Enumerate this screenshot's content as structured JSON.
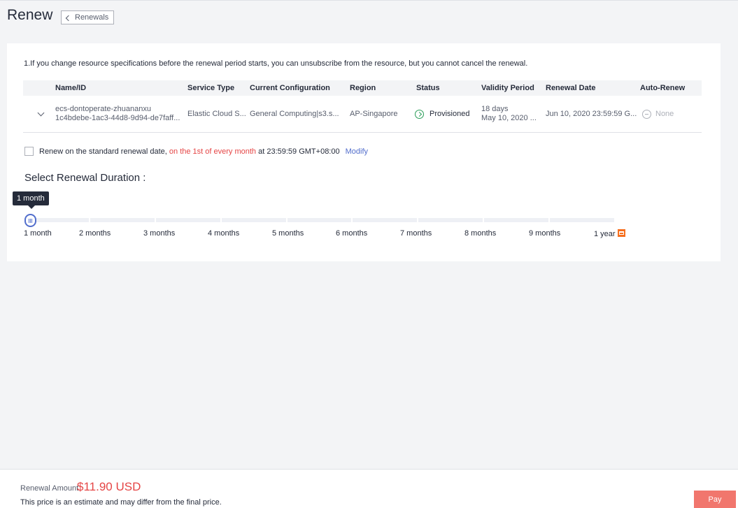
{
  "header": {
    "title": "Renew",
    "back_label": "Renewals"
  },
  "note": "1.If you change resource specifications before the renewal period starts, you can unsubscribe from the resource, but you cannot cancel the renewal.",
  "table": {
    "headers": [
      "Name/ID",
      "Service Type",
      "Current Configuration",
      "Region",
      "Status",
      "Validity Period",
      "Renewal Date",
      "Auto-Renew"
    ],
    "row": {
      "name": "ecs-dontoperate-zhuananxu",
      "id": "1c4bdebe-1ac3-44d8-9d94-de7faff...",
      "service_type": "Elastic Cloud S...",
      "configuration": "General Computing|s3.s...",
      "region": "AP-Singapore",
      "status": "Provisioned",
      "validity_days": "18 days",
      "validity_date": "May 10, 2020 ...",
      "renewal_date": "Jun 10, 2020 23:59:59 G...",
      "auto_renew": "None"
    }
  },
  "renew_option": {
    "prefix": "Renew on the standard renewal date,",
    "highlight": "on the 1st of every month",
    "suffix": "at 23:59:59 GMT+08:00",
    "modify_label": "Modify",
    "checked": false
  },
  "duration": {
    "title": "Select Renewal Duration :",
    "tooltip": "1 month",
    "selected_index": 0,
    "options": [
      "1 month",
      "2 months",
      "3 months",
      "4 months",
      "5 months",
      "6 months",
      "7 months",
      "8 months",
      "9 months",
      "1 year"
    ]
  },
  "footer": {
    "amount_label": "Renewal Amount",
    "amount": "$11.90 USD",
    "disclaimer": "This price is an estimate and may differ from the final price.",
    "pay_label": "Pay"
  },
  "colors": {
    "accent": "#526ecc",
    "price": "#e54545",
    "pay_button": "#f1766d",
    "status_ok": "#2a9d58",
    "calendar_icon": "#f66f1e"
  },
  "icons": [
    "chevron-left-icon",
    "chevron-down-icon",
    "status-provisioned-icon",
    "auto-renew-icon",
    "calendar-icon",
    "slider-grip-icon"
  ]
}
